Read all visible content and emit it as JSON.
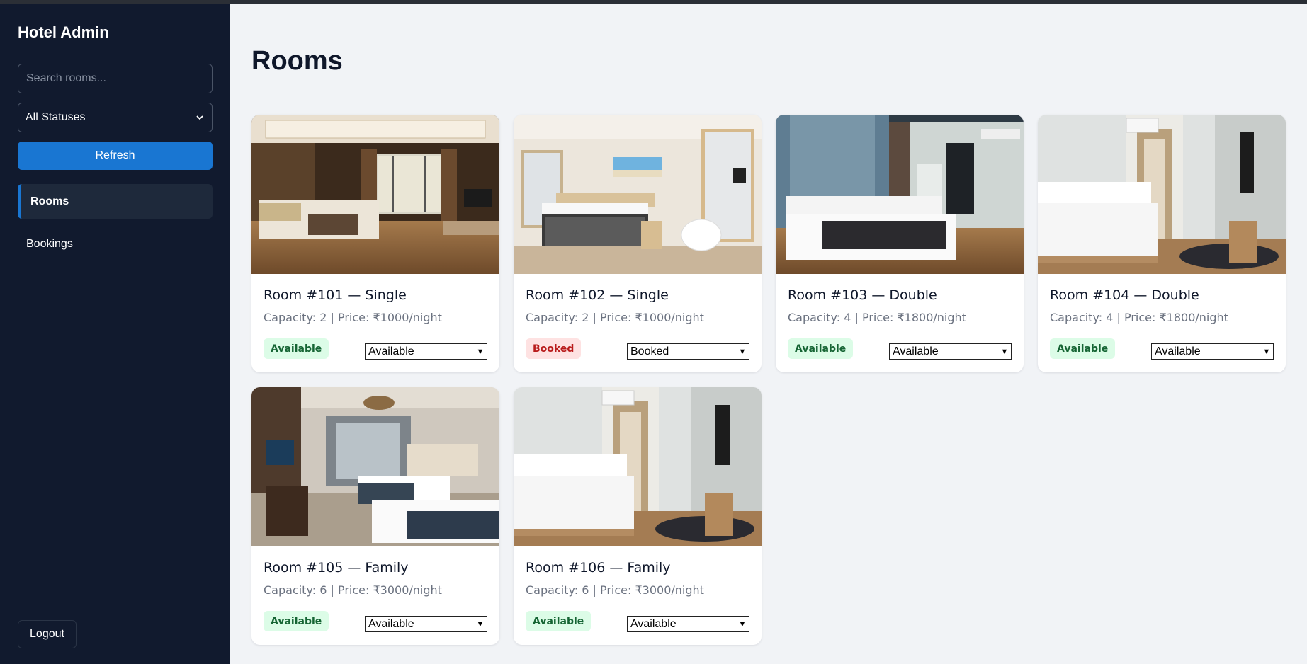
{
  "app": {
    "title": "Hotel Admin"
  },
  "sidebar": {
    "search_placeholder": "Search rooms...",
    "status_filter": "All Statuses",
    "refresh_label": "Refresh",
    "nav": [
      {
        "label": "Rooms",
        "active": true
      },
      {
        "label": "Bookings",
        "active": false
      }
    ],
    "logout_label": "Logout"
  },
  "main": {
    "title": "Rooms",
    "rooms": [
      {
        "title": "Room #101 — Single",
        "meta": "Capacity: 2 | Price: ₹1000/night",
        "badge": "Available",
        "status": "Available",
        "photo": "luxury-suite-photo"
      },
      {
        "title": "Room #102 — Single",
        "meta": "Capacity: 2 | Price: ₹1000/night",
        "badge": "Booked",
        "status": "Booked",
        "photo": "bright-double-room-photo"
      },
      {
        "title": "Room #103 — Double",
        "meta": "Capacity: 4 | Price: ₹1800/night",
        "badge": "Available",
        "status": "Available",
        "photo": "modern-dark-room-photo"
      },
      {
        "title": "Room #104 — Double",
        "meta": "Capacity: 4 | Price: ₹1800/night",
        "badge": "Available",
        "status": "Available",
        "photo": "white-room-tv-photo"
      },
      {
        "title": "Room #105 — Family",
        "meta": "Capacity: 6 | Price: ₹3000/night",
        "badge": "Available",
        "status": "Available",
        "photo": "twin-bed-room-photo"
      },
      {
        "title": "Room #106 — Family",
        "meta": "Capacity: 6 | Price: ₹3000/night",
        "badge": "Available",
        "status": "Available",
        "photo": "white-room-tv-photo"
      }
    ]
  },
  "colors": {
    "sidebar_bg": "#111a2e",
    "accent": "#1976d2",
    "available_bg": "#dcfce7",
    "available_text": "#166534",
    "booked_bg": "#fee2e2",
    "booked_text": "#b91c1c"
  }
}
